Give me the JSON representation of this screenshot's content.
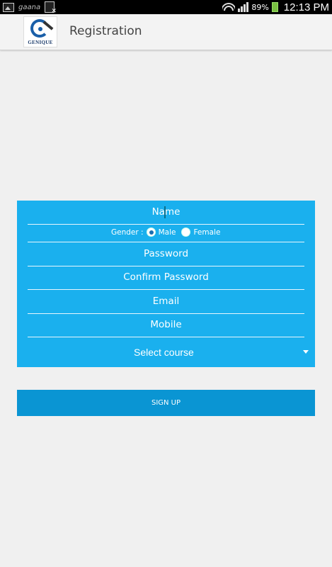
{
  "status_bar": {
    "app_name": "gaana",
    "battery": "89%",
    "time": "12:13 PM",
    "battery_color": "#7ac142"
  },
  "action_bar": {
    "logo_text": "GENIQUE",
    "title": "Registration"
  },
  "form": {
    "background_color": "#1ab0ee",
    "name_placeholder": "Name",
    "gender_label": "Gender :",
    "gender_options": [
      {
        "label": "Male",
        "selected": true
      },
      {
        "label": "Female",
        "selected": false
      }
    ],
    "password_placeholder": "Password",
    "confirm_password_placeholder": "Confirm Password",
    "email_placeholder": "Email",
    "mobile_placeholder": "Mobile",
    "course_select_value": "Select course"
  },
  "signup": {
    "label": "SIGN UP",
    "color": "#0a95d3"
  }
}
